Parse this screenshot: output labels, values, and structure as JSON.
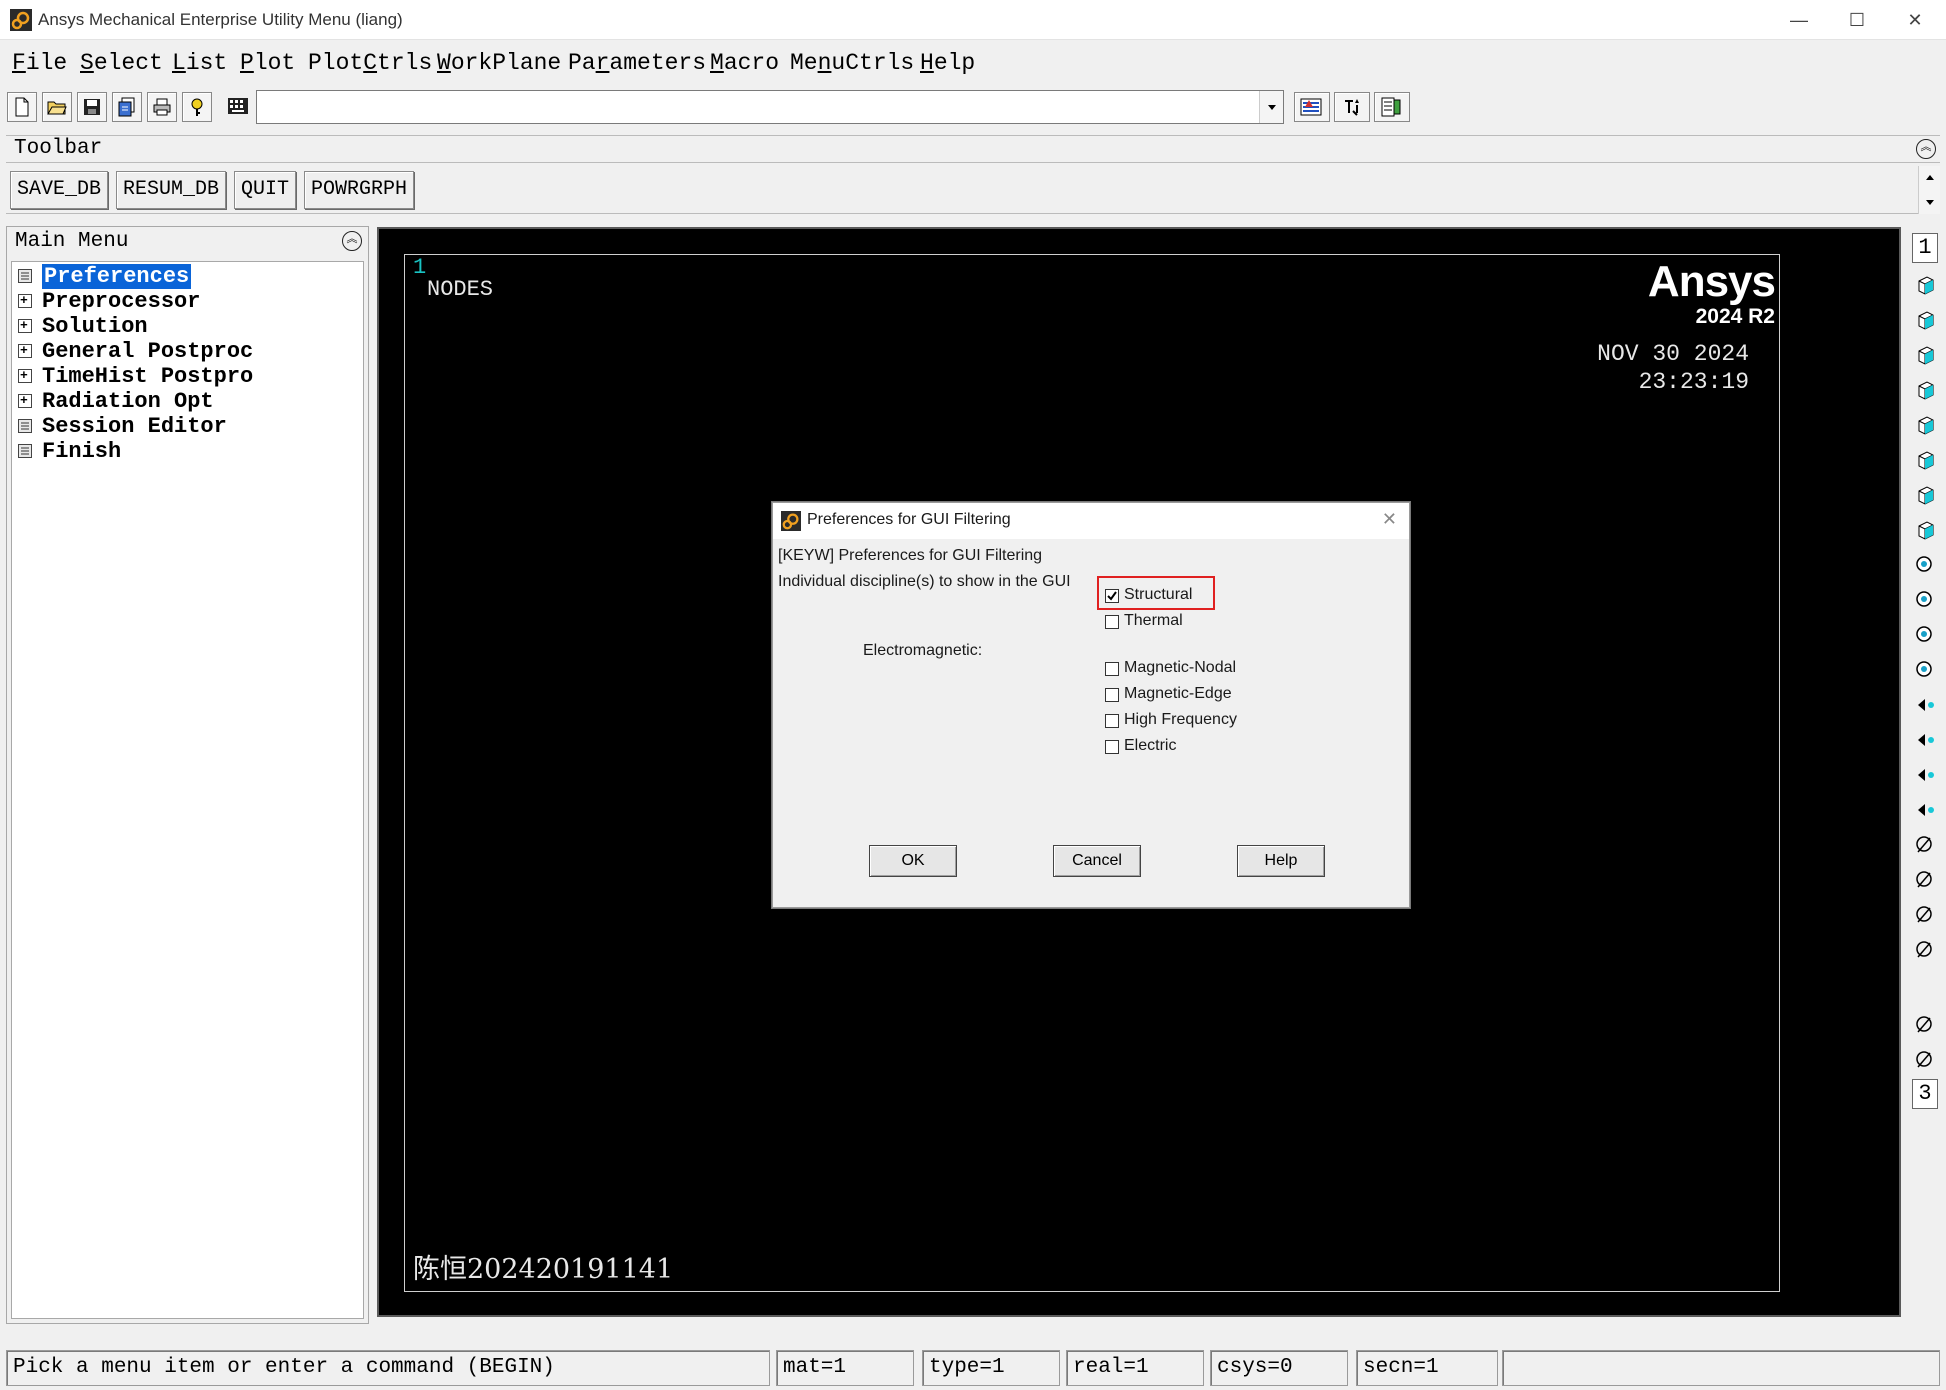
{
  "window": {
    "title": "Ansys Mechanical Enterprise Utility Menu (liang)",
    "minimize": "—",
    "maximize": "☐",
    "close": "✕"
  },
  "menubar": [
    {
      "label": "File",
      "u": "F",
      "rest": "ile"
    },
    {
      "label": "Select",
      "u": "S",
      "rest": "elect"
    },
    {
      "label": "List",
      "u": "L",
      "rest": "ist"
    },
    {
      "label": "Plot",
      "u": "P",
      "rest": "lot"
    },
    {
      "label": "PlotCtrls",
      "pre": "Plot",
      "u": "C",
      "rest": "trls"
    },
    {
      "label": "WorkPlane",
      "u": "W",
      "rest": "orkPlane"
    },
    {
      "label": "Parameters",
      "pre": "Pa",
      "u": "r",
      "rest": "ameters"
    },
    {
      "label": "Macro",
      "u": "M",
      "rest": "acro"
    },
    {
      "label": "MenuCtrls",
      "pre": "Me",
      "u": "n",
      "rest": "uCtrls"
    },
    {
      "label": "Help",
      "u": "H",
      "rest": "elp"
    }
  ],
  "command": {
    "value": "",
    "placeholder": ""
  },
  "toolbar": {
    "label": "Toolbar",
    "buttons": [
      "SAVE_DB",
      "RESUM_DB",
      "QUIT",
      "POWRGRPH"
    ]
  },
  "main_menu": {
    "header": "Main Menu",
    "items": [
      {
        "label": "Preferences",
        "icon": "document-icon",
        "selected": true
      },
      {
        "label": "Preprocessor",
        "icon": "expand-icon"
      },
      {
        "label": "Solution",
        "icon": "expand-icon"
      },
      {
        "label": "General Postproc",
        "icon": "expand-icon"
      },
      {
        "label": "TimeHist Postpro",
        "icon": "expand-icon"
      },
      {
        "label": "Radiation Opt",
        "icon": "expand-icon"
      },
      {
        "label": "Session Editor",
        "icon": "document-icon"
      },
      {
        "label": "Finish",
        "icon": "document-icon"
      }
    ]
  },
  "graphics": {
    "window_number": "1",
    "plot_label": "NODES",
    "logo": "Ansys",
    "version": "2024 R2",
    "date": "NOV 30 2024",
    "time": "23:23:19",
    "footer_text": "陈恒202420191141",
    "colors": {
      "background": "#000000",
      "window_number": "#19c3c3",
      "text": "#e8e8e8"
    }
  },
  "side_toolbar": {
    "top_index": "1",
    "bottom_index": "3"
  },
  "dialog": {
    "title": "Preferences for GUI Filtering",
    "keyword_line": "[KEYW] Preferences for GUI Filtering",
    "instruction": "Individual discipline(s) to show in the GUI",
    "group_label": "Electromagnetic:",
    "options": [
      {
        "label": "Structural",
        "checked": true,
        "highlighted": true
      },
      {
        "label": "Thermal",
        "checked": false
      },
      {
        "label": "Magnetic-Nodal",
        "checked": false
      },
      {
        "label": "Magnetic-Edge",
        "checked": false
      },
      {
        "label": "High Frequency",
        "checked": false
      },
      {
        "label": "Electric",
        "checked": false
      }
    ],
    "ok": "OK",
    "cancel": "Cancel",
    "help": "Help",
    "close": "✕",
    "highlight_color": "#e02020"
  },
  "statusbar": {
    "prompt": "Pick a menu item or enter a command (BEGIN)",
    "mat": "mat=1",
    "type": "type=1",
    "real": "real=1",
    "csys": "csys=0",
    "secn": "secn=1"
  }
}
